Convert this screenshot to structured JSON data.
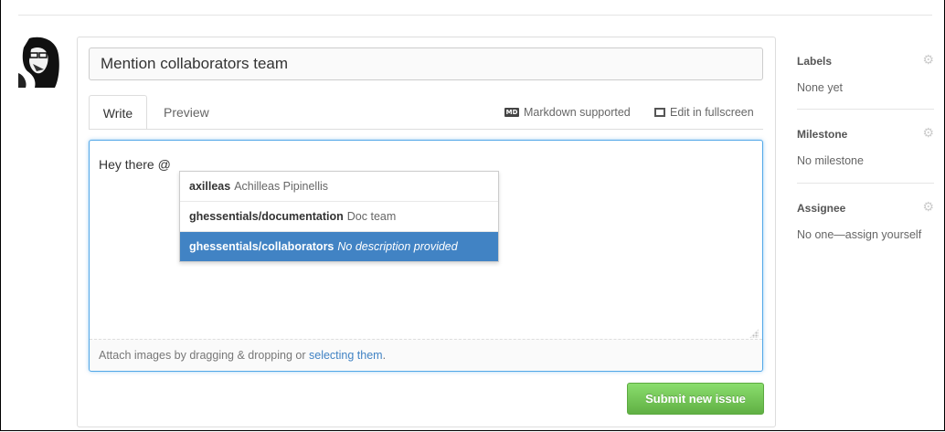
{
  "issue": {
    "title_value": "Mention collaborators team"
  },
  "tabs": [
    {
      "label": "Write",
      "active": true
    },
    {
      "label": "Preview",
      "active": false
    }
  ],
  "toolbar": {
    "markdown_icon": "MD",
    "markdown_label": "Markdown supported",
    "fullscreen_label": "Edit in fullscreen"
  },
  "editor": {
    "text": "Hey there @",
    "attach_prefix": "Attach images by dragging & dropping or ",
    "attach_link": "selecting them",
    "attach_suffix": "."
  },
  "mentions": [
    {
      "name": "axilleas",
      "desc": "Achilleas Pipinellis",
      "selected": false
    },
    {
      "name": "ghessentials/documentation",
      "desc": "Doc team",
      "selected": false
    },
    {
      "name": "ghessentials/collaborators",
      "desc": "No description provided",
      "selected": true
    }
  ],
  "submit_label": "Submit new issue",
  "sidebar": {
    "labels": {
      "title": "Labels",
      "value": "None yet"
    },
    "milestone": {
      "title": "Milestone",
      "value": "No milestone"
    },
    "assignee": {
      "title": "Assignee",
      "value": "No one—assign yourself"
    }
  },
  "colors": {
    "accent_blue": "#4183c4",
    "submit_green": "#60b044",
    "focus_border": "#51a7e8"
  }
}
